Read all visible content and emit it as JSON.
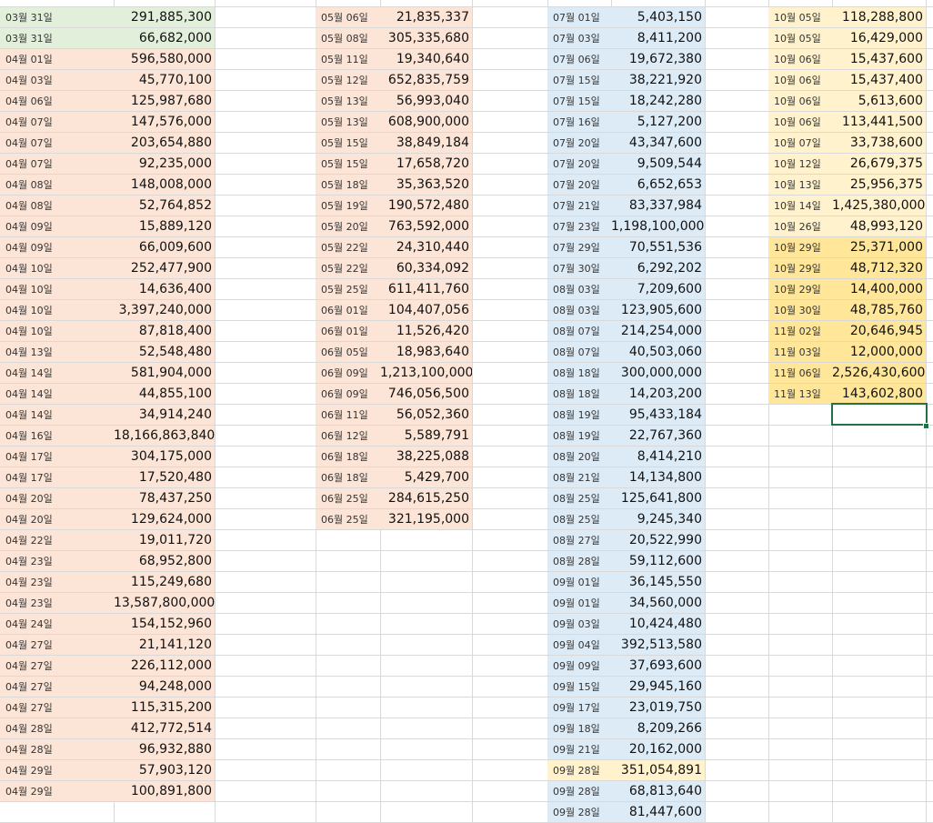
{
  "colors": {
    "green": "#e2efda",
    "salmon": "#fce4d6",
    "blue": "#ddebf7",
    "lightyellow": "#fff2cc",
    "gold": "#ffe699",
    "selection": "#217346"
  },
  "columns": [
    {
      "entries": [
        {
          "date": "03월 31일",
          "amount": "291,885,300",
          "fill": "green"
        },
        {
          "date": "03월 31일",
          "amount": "66,682,000",
          "fill": "green"
        },
        {
          "date": "04월 01일",
          "amount": "596,580,000",
          "fill": "salmon"
        },
        {
          "date": "04월 03일",
          "amount": "45,770,100",
          "fill": "salmon"
        },
        {
          "date": "04월 06일",
          "amount": "125,987,680",
          "fill": "salmon"
        },
        {
          "date": "04월 07일",
          "amount": "147,576,000",
          "fill": "salmon"
        },
        {
          "date": "04월 07일",
          "amount": "203,654,880",
          "fill": "salmon"
        },
        {
          "date": "04월 07일",
          "amount": "92,235,000",
          "fill": "salmon"
        },
        {
          "date": "04월 08일",
          "amount": "148,008,000",
          "fill": "salmon"
        },
        {
          "date": "04월 08일",
          "amount": "52,764,852",
          "fill": "salmon"
        },
        {
          "date": "04월 09일",
          "amount": "15,889,120",
          "fill": "salmon"
        },
        {
          "date": "04월 09일",
          "amount": "66,009,600",
          "fill": "salmon"
        },
        {
          "date": "04월 10일",
          "amount": "252,477,900",
          "fill": "salmon"
        },
        {
          "date": "04월 10일",
          "amount": "14,636,400",
          "fill": "salmon"
        },
        {
          "date": "04월 10일",
          "amount": "3,397,240,000",
          "fill": "salmon"
        },
        {
          "date": "04월 10일",
          "amount": "87,818,400",
          "fill": "salmon"
        },
        {
          "date": "04월 13일",
          "amount": "52,548,480",
          "fill": "salmon"
        },
        {
          "date": "04월 14일",
          "amount": "581,904,000",
          "fill": "salmon"
        },
        {
          "date": "04월 14일",
          "amount": "44,855,100",
          "fill": "salmon"
        },
        {
          "date": "04월 14일",
          "amount": "34,914,240",
          "fill": "salmon"
        },
        {
          "date": "04월 16일",
          "amount": "18,166,863,840",
          "fill": "salmon"
        },
        {
          "date": "04월 17일",
          "amount": "304,175,000",
          "fill": "salmon"
        },
        {
          "date": "04월 17일",
          "amount": "17,520,480",
          "fill": "salmon"
        },
        {
          "date": "04월 20일",
          "amount": "78,437,250",
          "fill": "salmon"
        },
        {
          "date": "04월 20일",
          "amount": "129,624,000",
          "fill": "salmon"
        },
        {
          "date": "04월 22일",
          "amount": "19,011,720",
          "fill": "salmon"
        },
        {
          "date": "04월 23일",
          "amount": "68,952,800",
          "fill": "salmon"
        },
        {
          "date": "04월 23일",
          "amount": "115,249,680",
          "fill": "salmon"
        },
        {
          "date": "04월 23일",
          "amount": "13,587,800,000",
          "fill": "salmon"
        },
        {
          "date": "04월 24일",
          "amount": "154,152,960",
          "fill": "salmon"
        },
        {
          "date": "04월 27일",
          "amount": "21,141,120",
          "fill": "salmon"
        },
        {
          "date": "04월 27일",
          "amount": "226,112,000",
          "fill": "salmon"
        },
        {
          "date": "04월 27일",
          "amount": "94,248,000",
          "fill": "salmon"
        },
        {
          "date": "04월 27일",
          "amount": "115,315,200",
          "fill": "salmon"
        },
        {
          "date": "04월 28일",
          "amount": "412,772,514",
          "fill": "salmon"
        },
        {
          "date": "04월 28일",
          "amount": "96,932,880",
          "fill": "salmon"
        },
        {
          "date": "04월 29일",
          "amount": "57,903,120",
          "fill": "salmon"
        },
        {
          "date": "04월 29일",
          "amount": "100,891,800",
          "fill": "salmon"
        }
      ]
    },
    {
      "entries": [
        {
          "date": "05월 06일",
          "amount": "21,835,337",
          "fill": "salmon"
        },
        {
          "date": "05월 08일",
          "amount": "305,335,680",
          "fill": "salmon"
        },
        {
          "date": "05월 11일",
          "amount": "19,340,640",
          "fill": "salmon"
        },
        {
          "date": "05월 12일",
          "amount": "652,835,759",
          "fill": "salmon"
        },
        {
          "date": "05월 13일",
          "amount": "56,993,040",
          "fill": "salmon"
        },
        {
          "date": "05월 13일",
          "amount": "608,900,000",
          "fill": "salmon"
        },
        {
          "date": "05월 15일",
          "amount": "38,849,184",
          "fill": "salmon"
        },
        {
          "date": "05월 15일",
          "amount": "17,658,720",
          "fill": "salmon"
        },
        {
          "date": "05월 18일",
          "amount": "35,363,520",
          "fill": "salmon"
        },
        {
          "date": "05월 19일",
          "amount": "190,572,480",
          "fill": "salmon"
        },
        {
          "date": "05월 20일",
          "amount": "763,592,000",
          "fill": "salmon"
        },
        {
          "date": "05월 22일",
          "amount": "24,310,440",
          "fill": "salmon"
        },
        {
          "date": "05월 22일",
          "amount": "60,334,092",
          "fill": "salmon"
        },
        {
          "date": "05월 25일",
          "amount": "611,411,760",
          "fill": "salmon"
        },
        {
          "date": "06월 01일",
          "amount": "104,407,056",
          "fill": "salmon"
        },
        {
          "date": "06월 01일",
          "amount": "11,526,420",
          "fill": "salmon"
        },
        {
          "date": "06월 05일",
          "amount": "18,983,640",
          "fill": "salmon"
        },
        {
          "date": "06월 09일",
          "amount": "1,213,100,000",
          "fill": "salmon"
        },
        {
          "date": "06월 09일",
          "amount": "746,056,500",
          "fill": "salmon"
        },
        {
          "date": "06월 11일",
          "amount": "56,052,360",
          "fill": "salmon"
        },
        {
          "date": "06월 12일",
          "amount": "5,589,791",
          "fill": "salmon"
        },
        {
          "date": "06월 18일",
          "amount": "38,225,088",
          "fill": "salmon"
        },
        {
          "date": "06월 18일",
          "amount": "5,429,700",
          "fill": "salmon"
        },
        {
          "date": "06월 25일",
          "amount": "284,615,250",
          "fill": "salmon"
        },
        {
          "date": "06월 25일",
          "amount": "321,195,000",
          "fill": "salmon"
        }
      ]
    },
    {
      "entries": [
        {
          "date": "07월 01일",
          "amount": "5,403,150",
          "fill": "blue"
        },
        {
          "date": "07월 03일",
          "amount": "8,411,200",
          "fill": "blue"
        },
        {
          "date": "07월 06일",
          "amount": "19,672,380",
          "fill": "blue"
        },
        {
          "date": "07월 15일",
          "amount": "38,221,920",
          "fill": "blue"
        },
        {
          "date": "07월 15일",
          "amount": "18,242,280",
          "fill": "blue"
        },
        {
          "date": "07월 16일",
          "amount": "5,127,200",
          "fill": "blue"
        },
        {
          "date": "07월 20일",
          "amount": "43,347,600",
          "fill": "blue"
        },
        {
          "date": "07월 20일",
          "amount": "9,509,544",
          "fill": "blue"
        },
        {
          "date": "07월 20일",
          "amount": "6,652,653",
          "fill": "blue"
        },
        {
          "date": "07월 21일",
          "amount": "83,337,984",
          "fill": "blue"
        },
        {
          "date": "07월 23일",
          "amount": "1,198,100,000",
          "fill": "blue"
        },
        {
          "date": "07월 29일",
          "amount": "70,551,536",
          "fill": "blue"
        },
        {
          "date": "07월 30일",
          "amount": "6,292,202",
          "fill": "blue"
        },
        {
          "date": "08월 03일",
          "amount": "7,209,600",
          "fill": "blue"
        },
        {
          "date": "08월 03일",
          "amount": "123,905,600",
          "fill": "blue"
        },
        {
          "date": "08월 07일",
          "amount": "214,254,000",
          "fill": "blue"
        },
        {
          "date": "08월 07일",
          "amount": "40,503,060",
          "fill": "blue"
        },
        {
          "date": "08월 18일",
          "amount": "300,000,000",
          "fill": "blue"
        },
        {
          "date": "08월 18일",
          "amount": "14,203,200",
          "fill": "blue"
        },
        {
          "date": "08월 19일",
          "amount": "95,433,184",
          "fill": "blue"
        },
        {
          "date": "08월 19일",
          "amount": "22,767,360",
          "fill": "blue"
        },
        {
          "date": "08월 20일",
          "amount": "8,414,210",
          "fill": "blue"
        },
        {
          "date": "08월 21일",
          "amount": "14,134,800",
          "fill": "blue"
        },
        {
          "date": "08월 25일",
          "amount": "125,641,800",
          "fill": "blue"
        },
        {
          "date": "08월 25일",
          "amount": "9,245,340",
          "fill": "blue"
        },
        {
          "date": "08월 27일",
          "amount": "20,522,990",
          "fill": "blue"
        },
        {
          "date": "08월 28일",
          "amount": "59,112,600",
          "fill": "blue"
        },
        {
          "date": "09월 01일",
          "amount": "36,145,550",
          "fill": "blue"
        },
        {
          "date": "09월 01일",
          "amount": "34,560,000",
          "fill": "blue"
        },
        {
          "date": "09월 03일",
          "amount": "10,424,480",
          "fill": "blue"
        },
        {
          "date": "09월 04일",
          "amount": "392,513,580",
          "fill": "blue"
        },
        {
          "date": "09월 09일",
          "amount": "37,693,600",
          "fill": "blue"
        },
        {
          "date": "09월 15일",
          "amount": "29,945,160",
          "fill": "blue"
        },
        {
          "date": "09월 17일",
          "amount": "23,019,750",
          "fill": "blue"
        },
        {
          "date": "09월 18일",
          "amount": "8,209,266",
          "fill": "blue"
        },
        {
          "date": "09월 21일",
          "amount": "20,162,000",
          "fill": "blue"
        },
        {
          "date": "09월 28일",
          "amount": "351,054,891",
          "fill": "lightyellow"
        },
        {
          "date": "09월 28일",
          "amount": "68,813,640",
          "fill": "blue"
        },
        {
          "date": "09월 28일",
          "amount": "81,447,600",
          "fill": "blue"
        }
      ]
    },
    {
      "entries": [
        {
          "date": "10월 05일",
          "amount": "118,288,800",
          "fill": "lightyellow"
        },
        {
          "date": "10월 05일",
          "amount": "16,429,000",
          "fill": "lightyellow"
        },
        {
          "date": "10월 06일",
          "amount": "15,437,600",
          "fill": "lightyellow"
        },
        {
          "date": "10월 06일",
          "amount": "15,437,400",
          "fill": "lightyellow"
        },
        {
          "date": "10월 06일",
          "amount": "5,613,600",
          "fill": "lightyellow"
        },
        {
          "date": "10월 06일",
          "amount": "113,441,500",
          "fill": "lightyellow"
        },
        {
          "date": "10월 07일",
          "amount": "33,738,600",
          "fill": "lightyellow"
        },
        {
          "date": "10월 12일",
          "amount": "26,679,375",
          "fill": "lightyellow"
        },
        {
          "date": "10월 13일",
          "amount": "25,956,375",
          "fill": "lightyellow"
        },
        {
          "date": "10월 14일",
          "amount": "1,425,380,000",
          "fill": "lightyellow"
        },
        {
          "date": "10월 26일",
          "amount": "48,993,120",
          "fill": "lightyellow"
        },
        {
          "date": "10월 29일",
          "amount": "25,371,000",
          "fill": "gold"
        },
        {
          "date": "10월 29일",
          "amount": "48,712,320",
          "fill": "gold"
        },
        {
          "date": "10월 29일",
          "amount": "14,400,000",
          "fill": "gold"
        },
        {
          "date": "10월 30일",
          "amount": "48,785,760",
          "fill": "gold"
        },
        {
          "date": "11월 02일",
          "amount": "20,646,945",
          "fill": "gold"
        },
        {
          "date": "11월 03일",
          "amount": "12,000,000",
          "fill": "gold"
        },
        {
          "date": "11월 06일",
          "amount": "2,526,430,600",
          "fill": "gold"
        },
        {
          "date": "11월 13일",
          "amount": "143,602,800",
          "fill": "gold"
        }
      ]
    }
  ]
}
